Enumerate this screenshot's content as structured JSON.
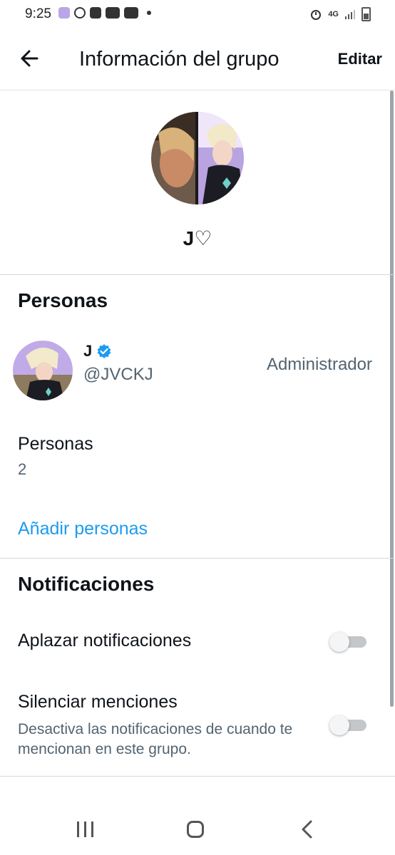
{
  "status_bar": {
    "time": "9:25",
    "network": "4G"
  },
  "header": {
    "title": "Información del grupo",
    "edit_label": "Editar"
  },
  "group": {
    "name": "J♡"
  },
  "people_section": {
    "title": "Personas",
    "members": [
      {
        "name": "J",
        "handle": "@JVCKJ",
        "role": "Administrador",
        "verified": true
      }
    ],
    "count_label": "Personas",
    "count_value": "2",
    "add_label": "Añadir personas"
  },
  "notifications_section": {
    "title": "Notificaciones",
    "settings": [
      {
        "label": "Aplazar notificaciones",
        "enabled": false
      },
      {
        "label": "Silenciar menciones",
        "description": "Desactiva las notificaciones de cuando te mencionan en este grupo.",
        "enabled": false
      }
    ]
  },
  "colors": {
    "accent": "#1d9bf0",
    "secondary_text": "#536471",
    "primary_text": "#0f1419"
  },
  "icons": {
    "back": "arrow-left-icon",
    "verified": "verified-badge-icon",
    "nav_recents": "recents-icon",
    "nav_home": "home-icon",
    "nav_back": "chevron-left-icon"
  }
}
